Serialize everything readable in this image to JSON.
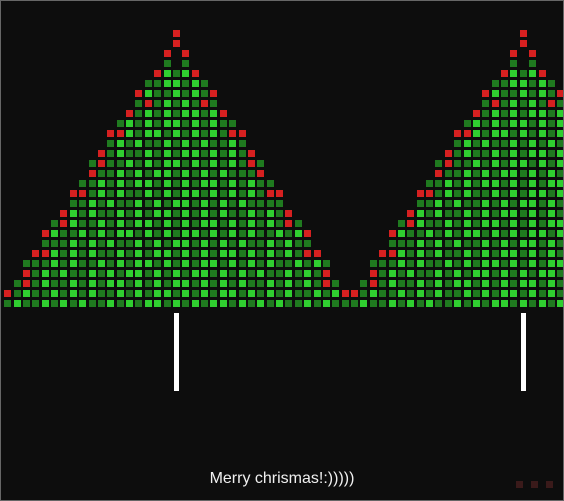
{
  "message": "Merry chrismas!:)))))",
  "trees": [
    {
      "accent": "r"
    },
    {
      "accent": "r"
    },
    {
      "accent": "oy"
    }
  ]
}
